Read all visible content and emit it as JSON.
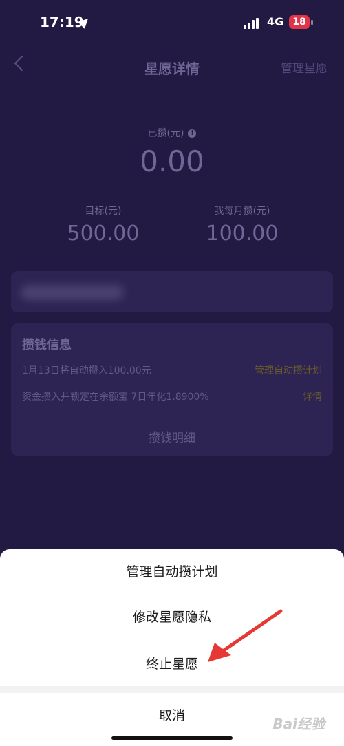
{
  "status_bar": {
    "time": "17:19",
    "network": "4G",
    "battery": "18"
  },
  "nav": {
    "title": "星愿详情",
    "right_action": "管理星愿"
  },
  "summary": {
    "saved_label": "已攒(元)",
    "saved_amount": "0.00",
    "target_label": "目标(元)",
    "target_value": "500.00",
    "monthly_label": "我每月攒(元)",
    "monthly_value": "100.00"
  },
  "info_card": {
    "title": "攒钱信息",
    "row1_text": "1月13日将自动攒入100.00元",
    "row1_link": "管理自动攒计划",
    "row2_text": "资金攒入并锁定在余额宝 7日年化1.8900%",
    "row2_link": "详情",
    "details_button": "攒钱明细"
  },
  "action_sheet": {
    "items": [
      "管理自动攒计划",
      "修改星愿隐私",
      "终止星愿"
    ],
    "cancel": "取消"
  },
  "watermark": "Bai经验",
  "colors": {
    "background": "#231a44",
    "accent_link": "#6a5a2a",
    "arrow": "#e53935"
  }
}
